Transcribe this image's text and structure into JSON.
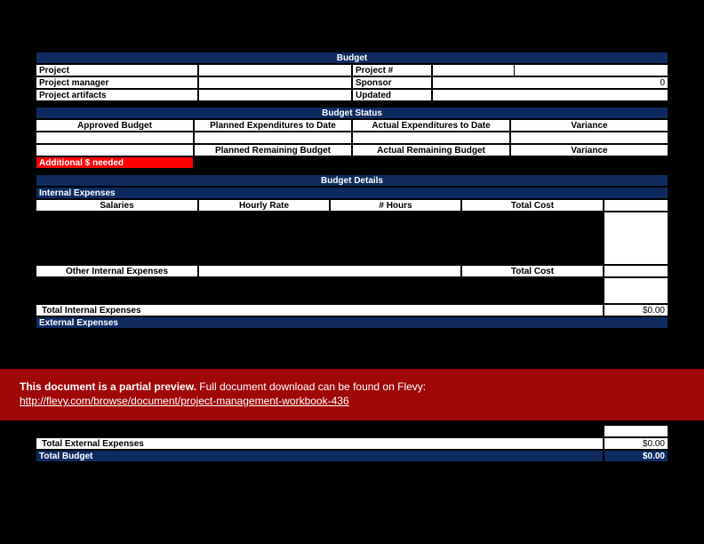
{
  "title": "Budget",
  "fields": {
    "project_label": "Project",
    "project_num_label": "Project #",
    "pm_label": "Project manager",
    "sponsor_label": "Sponsor",
    "sponsor_value": "0",
    "artifacts_label": "Project artifacts",
    "updated_label": "Updated"
  },
  "status": {
    "header": "Budget Status",
    "approved": "Approved Budget",
    "planned_to_date": "Planned Expenditures to Date",
    "actual_to_date": "Actual Expenditures to Date",
    "variance": "Variance",
    "planned_remaining": "Planned Remaining Budget",
    "actual_remaining": "Actual Remaining Budget",
    "additional_needed": "Additional $ needed"
  },
  "details": {
    "header": "Budget Details",
    "internal_header": "Internal Expenses",
    "salaries": "Salaries",
    "hourly_rate": "Hourly Rate",
    "hours": "# Hours",
    "total_cost": "Total Cost",
    "other_internal": "Other Internal Expenses",
    "total_internal": "Total Internal Expenses",
    "total_internal_val": "$0.00",
    "external_header": "External Expenses",
    "total_external": "Total External Expenses",
    "total_external_val": "$0.00",
    "total_budget": "Total Budget",
    "total_budget_val": "$0.00"
  },
  "banner": {
    "bold": "This document is a partial preview.",
    "rest": "  Full document download can be found on Flevy:",
    "link": "http://flevy.com/browse/document/project-management-workbook-436"
  }
}
